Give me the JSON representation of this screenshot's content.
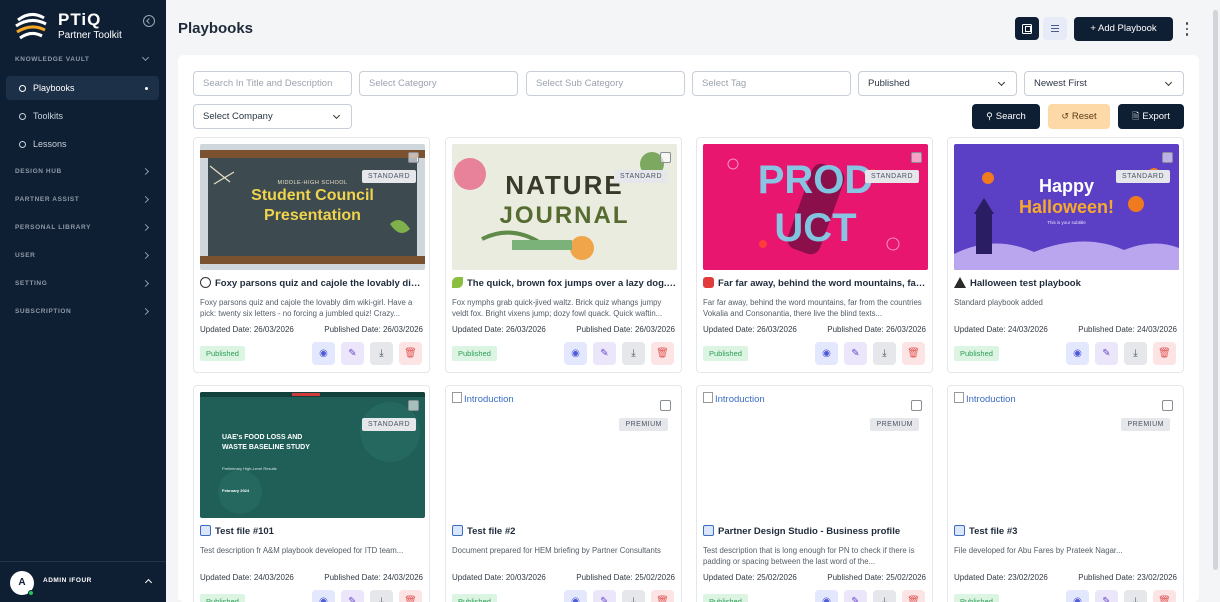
{
  "brand": {
    "title": "PTiQ",
    "subtitle": "Partner Toolkit"
  },
  "sidebar": {
    "sections": [
      {
        "label": "KNOWLEDGE VAULT"
      },
      {
        "label": "DESIGN HUB"
      },
      {
        "label": "PARTNER ASSIST"
      },
      {
        "label": "PERSONAL LIBRARY"
      },
      {
        "label": "USER"
      },
      {
        "label": "SETTING"
      },
      {
        "label": "SUBSCRIPTION"
      }
    ],
    "items": [
      {
        "label": "Playbooks"
      },
      {
        "label": "Toolkits"
      },
      {
        "label": "Lessons"
      }
    ],
    "user": {
      "initial": "A",
      "name": "ADMIN IFOUR"
    }
  },
  "header": {
    "title": "Playbooks",
    "add_label": "+ Add Playbook"
  },
  "filters": {
    "search_placeholder": "Search In Title and Description",
    "category_placeholder": "Select Category",
    "subcategory_placeholder": "Select Sub Category",
    "tag_placeholder": "Select Tag",
    "status_value": "Published",
    "sort_value": "Newest First",
    "company_value": "Select Company",
    "search_label": "Search",
    "reset_label": "Reset",
    "export_label": "Export"
  },
  "cards": [
    {
      "type": "STANDARD",
      "title": "Foxy parsons quiz and cajole the lovably dim ...",
      "desc": "Foxy parsons quiz and cajole the lovably dim wiki-girl. Have a pick: twenty six letters - no forcing a jumbled quiz! Crazy...",
      "updated": "Updated Date: 26/03/2026",
      "published": "Published Date: 26/03/2026",
      "status": "Published",
      "thumb_text_1": "MIDDLE-HIGH SCHOOL",
      "thumb_text_2": "Student Council",
      "thumb_text_3": "Presentation"
    },
    {
      "type": "STANDARD",
      "title": "The quick, brown fox jumps over a lazy dog. ...",
      "desc": "Fox nymphs grab quick-jived waltz. Brick quiz whangs jumpy veldt fox. Bright vixens jump; dozy fowl quack. Quick waftin...",
      "updated": "Updated Date: 26/03/2026",
      "published": "Published Date: 26/03/2026",
      "status": "Published",
      "thumb_text_1": "NATURE",
      "thumb_text_2": "JOURNAL"
    },
    {
      "type": "STANDARD",
      "title": "Far far away, behind the word mountains, far ...",
      "desc": "Far far away, behind the word mountains, far from the countries Vokalia and Consonantia, there live the blind texts...",
      "updated": "Updated Date: 26/03/2026",
      "published": "Published Date: 26/03/2026",
      "status": "Published",
      "thumb_text_1": "PROD",
      "thumb_text_2": "UCT"
    },
    {
      "type": "STANDARD",
      "title": "Halloween test playbook",
      "desc": "Standard playbook added",
      "updated": "Updated Date: 24/03/2026",
      "published": "Published Date: 24/03/2026",
      "status": "Published",
      "thumb_text_1": "Happy",
      "thumb_text_2": "Halloween!",
      "thumb_text_3": "This is your subtitle"
    },
    {
      "type": "STANDARD",
      "title": "Test file #101",
      "desc": "Test description fr A&M playbook developed for ITD team...",
      "updated": "Updated Date: 24/03/2026",
      "published": "Published Date: 24/03/2026",
      "status": "Published",
      "thumb_text_1": "UAE's FOOD LOSS AND",
      "thumb_text_2": "WASTE BASELINE STUDY",
      "thumb_text_3": "Preliminary High-Level Results",
      "thumb_text_4": "February 2024"
    },
    {
      "type": "PREMIUM",
      "title": "Test file #2",
      "desc": "Document prepared for HEM briefing by Partner Consultants",
      "updated": "Updated Date: 20/03/2026",
      "published": "Published Date: 25/02/2026",
      "status": "Published",
      "alt": "Introduction"
    },
    {
      "type": "PREMIUM",
      "title": "Partner Design Studio - Business profile",
      "desc": "Test description that is long enough for PN to check if there is padding or spacing between the last word of the...",
      "updated": "Updated Date: 25/02/2026",
      "published": "Published Date: 25/02/2026",
      "status": "Published",
      "alt": "Introduction"
    },
    {
      "type": "PREMIUM",
      "title": "Test file #3",
      "desc": "File developed for Abu Fares by Prateek Nagar...",
      "updated": "Updated Date: 23/02/2026",
      "published": "Published Date: 23/02/2026",
      "status": "Published",
      "alt": "Introduction"
    }
  ],
  "icons": {
    "view": "eye-icon",
    "edit": "pencil-icon",
    "download": "download-icon",
    "delete": "trash-icon"
  },
  "colors": {
    "sidebar": "#0f1f33",
    "accent": "#0f1f33",
    "reset": "#fdd9a8",
    "published": "#2f9d57"
  }
}
